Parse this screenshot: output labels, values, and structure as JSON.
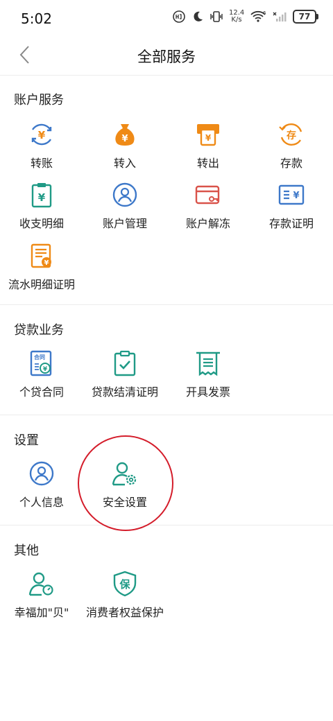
{
  "status_bar": {
    "time": "5:02",
    "net_speed_value": "12.4",
    "net_speed_unit": "K/s",
    "signal_badge": "6",
    "battery": "77"
  },
  "header": {
    "title": "全部服务"
  },
  "sections": {
    "account": {
      "title": "账户服务",
      "items": [
        "转账",
        "转入",
        "转出",
        "存款",
        "收支明细",
        "账户管理",
        "账户解冻",
        "存款证明",
        "流水明细证明"
      ]
    },
    "loan": {
      "title": "贷款业务",
      "items": [
        "个贷合同",
        "贷款结清证明",
        "开具发票"
      ]
    },
    "settings": {
      "title": "设置",
      "items": [
        "个人信息",
        "安全设置"
      ]
    },
    "other": {
      "title": "其他",
      "items": [
        "幸福加\"贝\"",
        "消费者权益保护"
      ]
    }
  },
  "icon_text": {
    "contract": "合同",
    "protect": "保",
    "deposit": "存",
    "yuan": "¥"
  },
  "colors": {
    "blue": "#3d78c9",
    "orange": "#ef8a16",
    "red": "#d9534a",
    "green": "#1f9a86",
    "highlight": "#d41c2a"
  }
}
